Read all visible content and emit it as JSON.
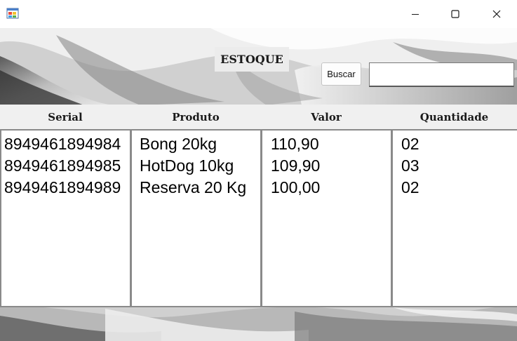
{
  "window": {
    "icon": "winforms-app-icon",
    "controls": {
      "minimize_icon": "minimize-icon",
      "maximize_icon": "maximize-icon",
      "close_icon": "close-icon"
    }
  },
  "form": {
    "title": "ESTOQUE",
    "search_button": "Buscar",
    "search_value": ""
  },
  "columns": [
    {
      "header": "Serial",
      "items": [
        "8949461894984",
        "8949461894985",
        "8949461894989"
      ]
    },
    {
      "header": "Produto",
      "items": [
        "Bong 20kg",
        "HotDog 10kg",
        "Reserva 20 Kg"
      ]
    },
    {
      "header": "Valor",
      "items": [
        "110,90",
        "109,90",
        "100,00"
      ]
    },
    {
      "header": "Quantidade",
      "items": [
        "02",
        "03",
        "02"
      ]
    }
  ]
}
